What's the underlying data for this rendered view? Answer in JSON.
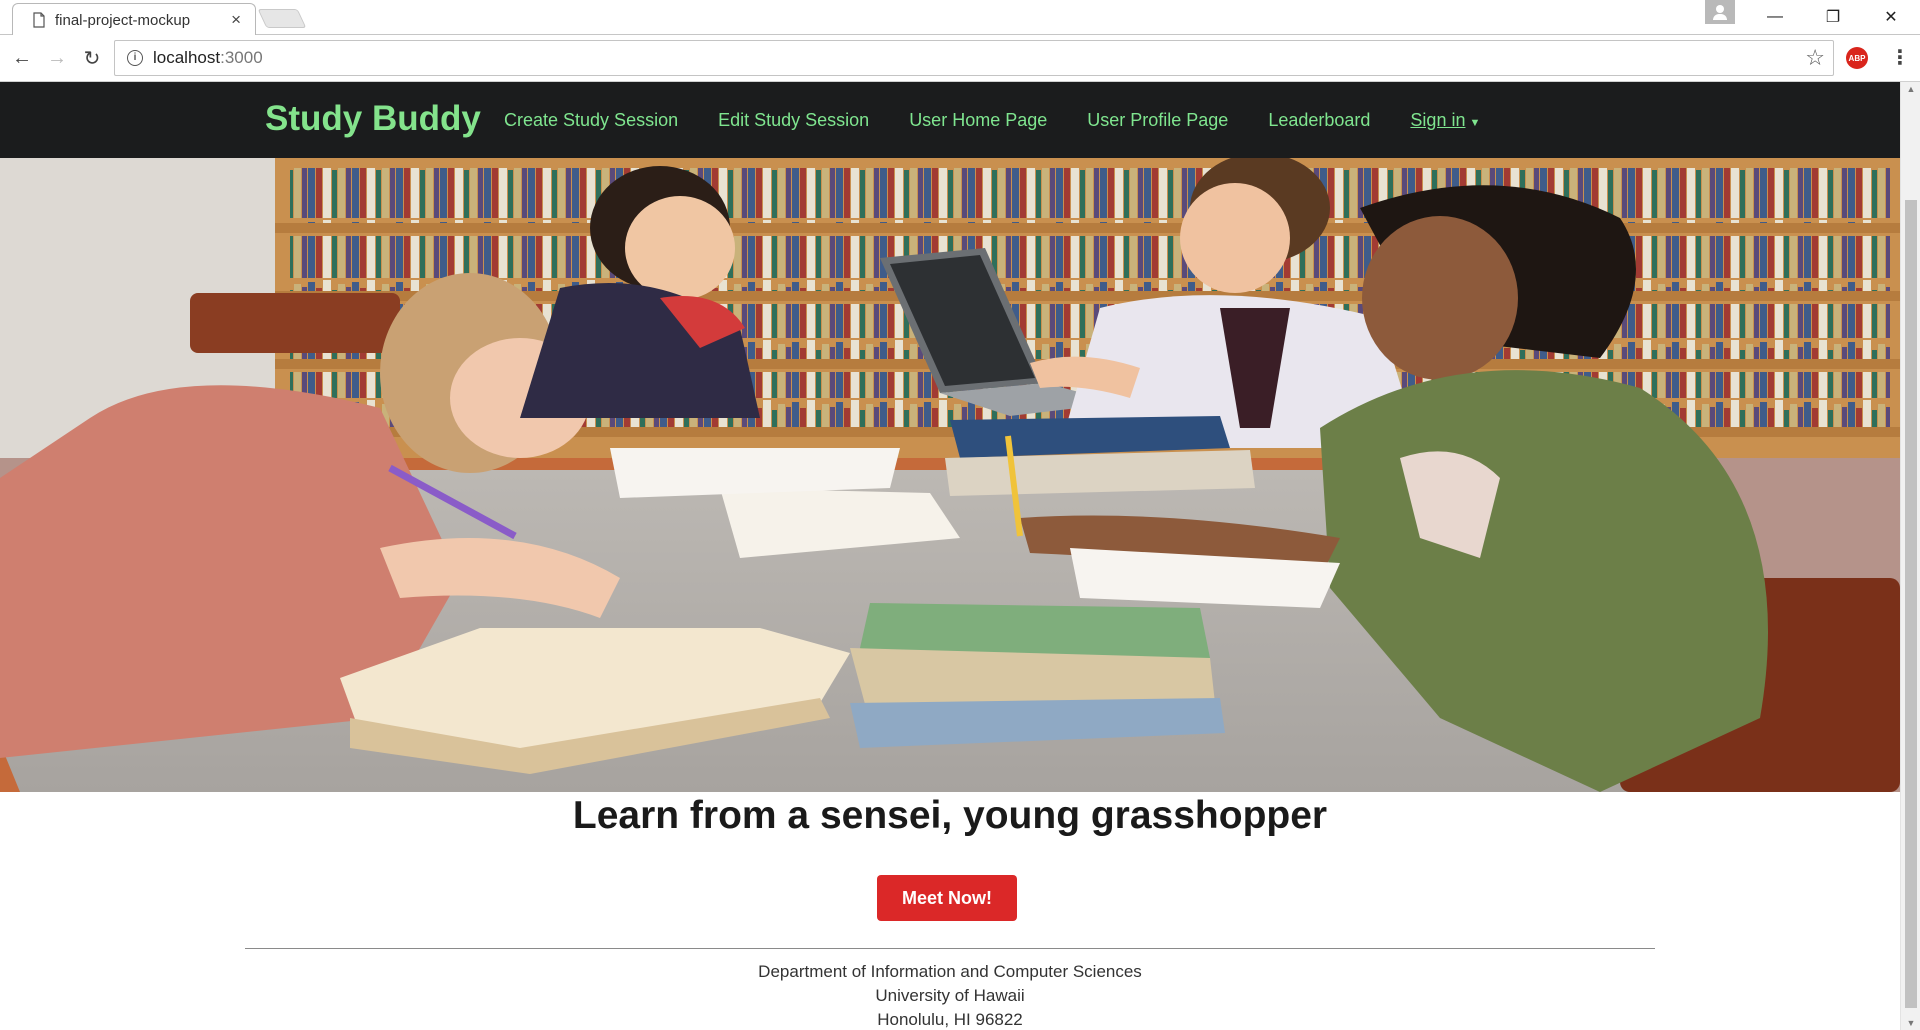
{
  "browser": {
    "tab_title": "final-project-mockup",
    "tab_close": "×",
    "url_host": "localhost",
    "url_port": ":3000",
    "abp_label": "ABP",
    "minimize": "—",
    "restore": "❐",
    "close": "✕"
  },
  "navbar": {
    "brand": "Study Buddy",
    "items": [
      {
        "label": "Create Study Session"
      },
      {
        "label": "Edit Study Session"
      },
      {
        "label": "User Home Page"
      },
      {
        "label": "User Profile Page"
      },
      {
        "label": "Leaderboard"
      }
    ],
    "signin": "Sign in",
    "signin_caret": "▼"
  },
  "main": {
    "headline": "Learn from a sensei, young grasshopper",
    "cta_label": "Meet Now!"
  },
  "footer": {
    "line1": "Department of Information and Computer Sciences",
    "line2": "University of Hawaii",
    "line3": "Honolulu, HI 96822"
  },
  "colors": {
    "navbar_bg": "#1b1c1d",
    "brand": "#84e38c",
    "link": "#7fe58f",
    "cta": "#db2828"
  }
}
